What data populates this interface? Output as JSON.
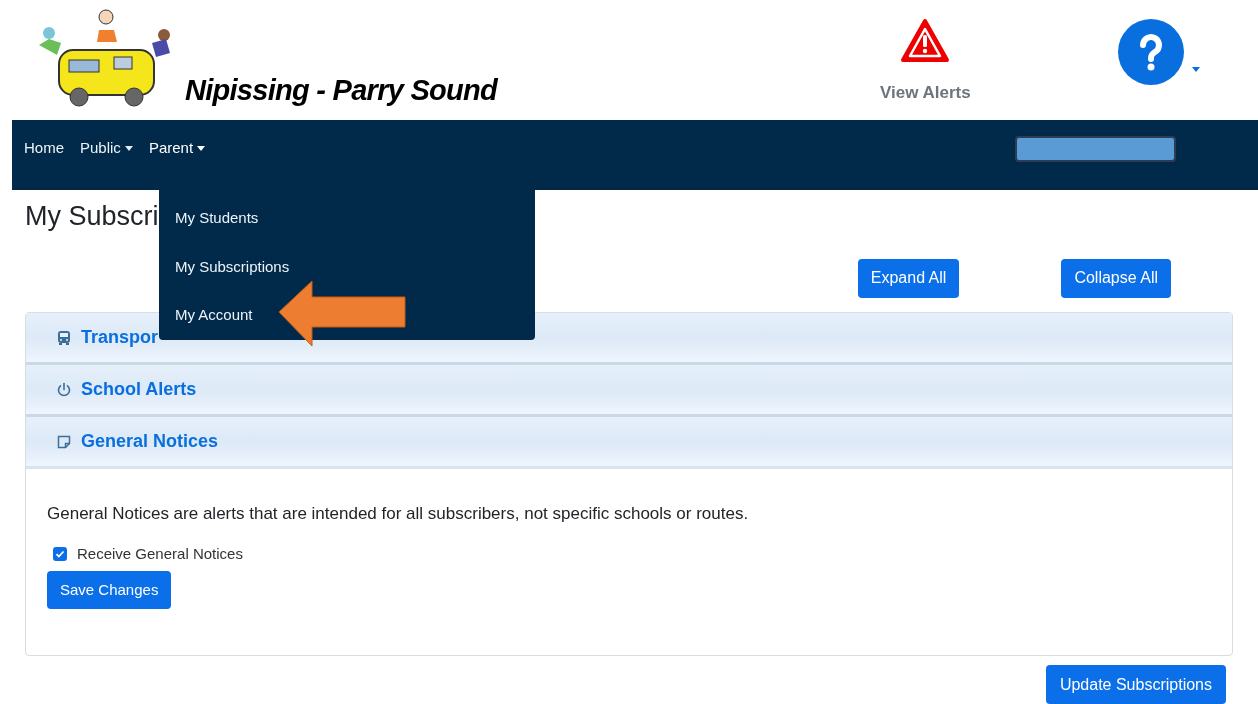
{
  "header": {
    "title": "Nipissing - Parry Sound",
    "alerts_label": "View Alerts"
  },
  "nav": {
    "items": [
      {
        "label": "Home",
        "has_menu": false,
        "expanded": false
      },
      {
        "label": "Public",
        "has_menu": true,
        "expanded": false
      },
      {
        "label": "Parent",
        "has_menu": true,
        "expanded": true
      }
    ],
    "menu": [
      "My Students",
      "My Subscriptions",
      "My Account"
    ]
  },
  "page_title": "My Subscri",
  "buttons": {
    "expand": "Expand All",
    "collapse": "Collapse All",
    "update": "Update Subscriptions"
  },
  "sections": [
    {
      "kind": "bus",
      "title": "Transpor",
      "expanded": false
    },
    {
      "kind": "power",
      "title": "School Alerts",
      "expanded": false
    },
    {
      "kind": "note",
      "title": "General Notices",
      "expanded": true,
      "description": "General Notices are alerts that are intended for all subscribers, not specific schools or routes.",
      "checkbox": {
        "label": "Receive General Notices",
        "checked": true
      },
      "save": "Save Changes"
    }
  ]
}
